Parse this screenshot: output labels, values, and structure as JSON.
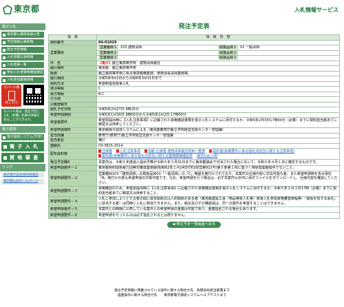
{
  "header": {
    "logo_text": "東京都",
    "service_name": "入札情報サービス"
  },
  "sidebar": {
    "section1_title": "電子入札",
    "items": [
      {
        "label": "東京都公報等発表公告"
      },
      {
        "label": "予定価格公表情報"
      },
      {
        "label": "発注予定情報"
      },
      {
        "label": "入札見積公表情報"
      },
      {
        "label": "入札結果一覧"
      },
      {
        "label": "参加入札者資格審査確認"
      },
      {
        "label": "入札参加資格情報"
      }
    ],
    "mobile_badge_line1": "モバイル版",
    "mobile_badge_line2": "はこちら",
    "mobile_note": "モバイル版は、発注予定と入札（見積）結果の情報を見ることができます。",
    "section2_title": "電子調達",
    "electronic_system": "電子調達システム(TOP)",
    "big_items": [
      {
        "label": "電 子 入 札"
      },
      {
        "label": "資 格 審 査"
      }
    ],
    "section3_title": "リンク",
    "links": [
      {
        "label": "東京電子自治体共同運営"
      },
      {
        "label": "東京都公式ホームページ"
      }
    ]
  },
  "main": {
    "title": "発注予定表",
    "col_header_item": "項　目",
    "col_header_content": "項　目　内　容",
    "contract_no_label": "契約番号",
    "contract_no": "04-01029",
    "business_type_label": "営業種目",
    "business_rows": [
      {
        "k1": "営業種目１",
        "v1": "103 建物清掃",
        "k2": "取扱品目１",
        "v2": "01 一般清掃"
      },
      {
        "k1": "営業種目２",
        "v1": "",
        "k2": "取扱品目２",
        "v2": ""
      },
      {
        "k1": "営業種目３",
        "v1": "",
        "k2": "取扱品目３",
        "v2": ""
      }
    ],
    "fields": [
      {
        "label": "件　名",
        "tag": "【電子】",
        "value": "都立東高等学校　建物清掃委託"
      },
      {
        "label": "履行場所",
        "value": "東京都　都立東高等学校"
      },
      {
        "label": "概要",
        "value": "都立東高等学校に係る環境整備業務、使用消毒清掃業務等。"
      },
      {
        "label": "履行期間",
        "value": "令和5年4月1日から令和6年3月31日まで"
      },
      {
        "label": "契約方法",
        "value": "希望制指名競争入札"
      },
      {
        "label": "発注等級",
        "value": "C"
      },
      {
        "label": "受付等級",
        "value": "B,C"
      },
      {
        "label": "その他",
        "value": ""
      },
      {
        "label": "公報登載日",
        "value": ""
      },
      {
        "label": "開札予定日時",
        "value": "令和5年2月27日 9時15分"
      },
      {
        "label": "希望申請期間",
        "value": "令和5年1月30日 9時00分から令和5年2月3日 17時00分"
      },
      {
        "label": "希望者要件",
        "value": "希望票提出時に【入札注意事項】に記載された資格確認書類を電子入札システムに添付するか、令和5年2月3日17時00分（必着）までに契約担当者あてに郵送又は持参してください。"
      },
      {
        "label": "希望申請場所",
        "value": "東京都電子調達システムによる（東京都教育庁都立学校経営支援センター管理課）"
      },
      {
        "label": "担当部課",
        "value": "教育庁(教育庁)都立学校経営支援センター管理課"
      },
      {
        "label": "担当者名",
        "value": "横戸"
      },
      {
        "label": "連絡先",
        "value": "03-3815-2514"
      }
    ],
    "attachments_label": "配布資料等",
    "attachments": [
      {
        "name": "仕様書"
      },
      {
        "name": "入札注意事項"
      },
      {
        "name": "別紙 仕様書 建物清掃委託項目一覧表"
      },
      {
        "name": "誓約書(資格要件に係る強化法該当に関する注意事項)"
      },
      {
        "name": "誓約書(資格要件に係る強化法該当に関する業務経験確認票"
      }
    ],
    "attachments_more": "様式の記入例",
    "requirements": [
      {
        "label": "発注予定欄4",
        "value": "本案件は、令和５年度過入遠出予算が令和５年３月31日までに東京都議会で可決された場合において、令和５年４月１日に確定するものです。"
      },
      {
        "label": "希望申請要件－１",
        "value": "東京都契約関係暴力団等対策措置要綱(昭和62年１月14日付61財営第922号)第５条第１項に基づく排除措置期間中でないこと。"
      },
      {
        "label": "希望申請要件－２",
        "value": "営業種目103「建物清掃」の取扱品目01「一般清掃」の「C」等級を格付けされており、本案件の仕様内容に対応可能な者。また希望申請時を含み現在「B」格付けの者も希望申請の対象可能です。なお、希望申請を行う場合は、必ず本案件公示中に添付ファイルをダウンロードし、仕様内容を確認してください。"
      },
      {
        "label": "希望申請要件－３",
        "value": "資格確認のため、希望票提出時に【入札注意事項】に記載された資格確認書類を電子入札システムに添付するか、令和５年２月３日17時（必着）までに契約担当者あてに郵送又は持参すること。"
      },
      {
        "label": "希望申請要件－４",
        "value": "入札に参加しようとする者の間に資本関係又は人的関係がある者（東京都建設工事（物品等賃入札等）競争入札参加資格審査規程等）「関係を有する会社」に該当する者）は同時に入札に参加できません。また、組合及びその構成員は、同一の案件を希望することはできません。"
      },
      {
        "label": "希望申請要件－５",
        "value": "本案件と同時期に公表している案件との希望申請の重複は可能であり、重複指名される場合もあります。"
      },
      {
        "label": "希望申請要件－６",
        "value": "希望申請を行ったものは必ず指名されるとは限りません。"
      }
    ],
    "back_button": "発注予定一覧画面へ戻る"
  },
  "footer": {
    "line1": "発注予定情報に掲載されている案件に関する問合せ先　各関係局担当部署まで",
    "line2": "画面操作に関する問合せ先　　東京都電子調達システムヘルプデスクまで"
  },
  "colors": {
    "brand_green": "#1f7a3a",
    "label_green": "#b7d7b0",
    "accent_red": "#d6311f",
    "link_blue": "#1f5fbf"
  }
}
